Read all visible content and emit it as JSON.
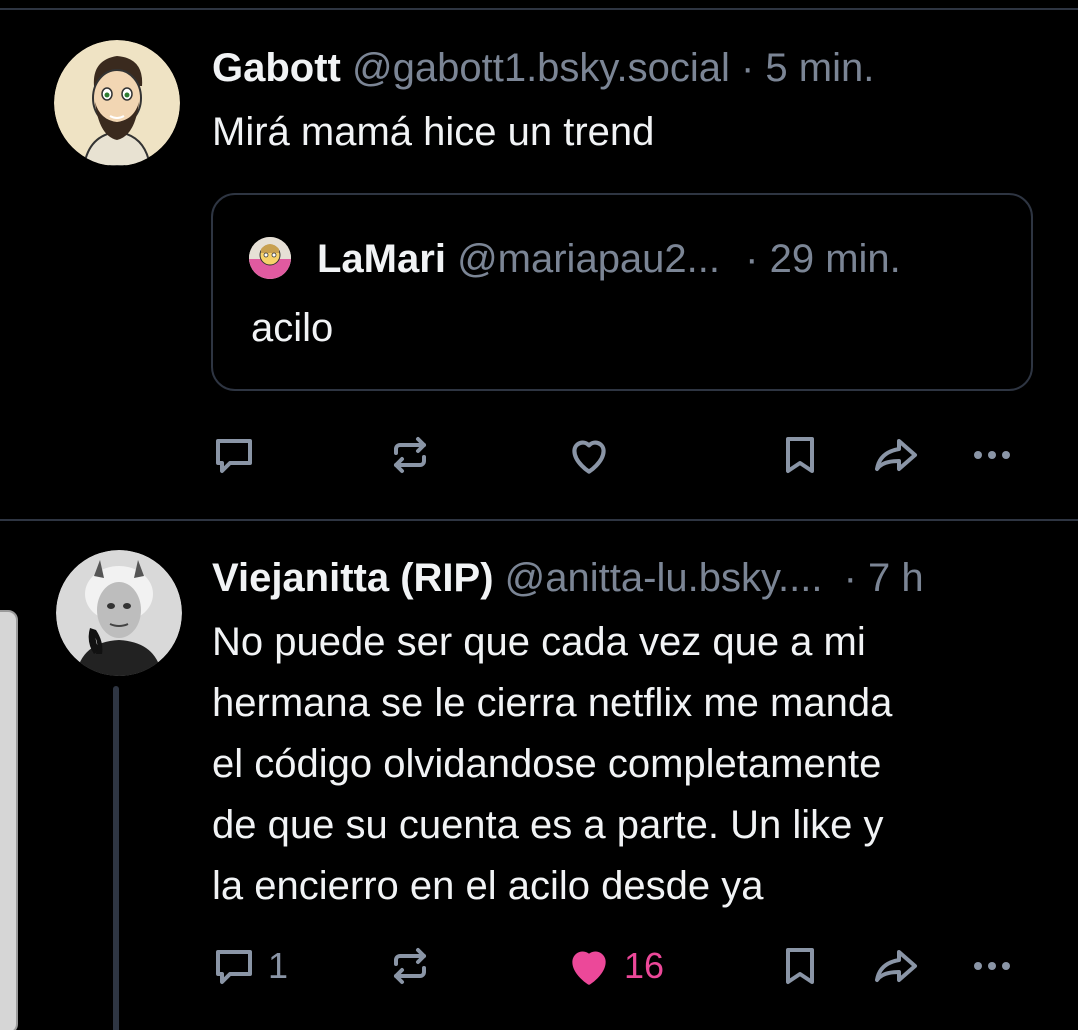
{
  "posts": [
    {
      "author": "Gabott",
      "handle": "@gabott1.bsky.social",
      "separator": "·",
      "time": "5 min.",
      "text": "Mirá mamá hice un trend",
      "quote": {
        "author": "LaMari",
        "handle": "@mariapau2...",
        "separator": "·",
        "time": "29 min.",
        "text": "acilo"
      },
      "actions": {
        "reply_count": "",
        "repost_count": "",
        "like_count": "",
        "liked": false
      }
    },
    {
      "author": "Viejanitta (RIP)",
      "handle": "@anitta-lu.bsky....",
      "separator": "·",
      "time": "7 h",
      "text": "No puede ser que cada vez que a mi\nhermana se le cierra netflix me manda\nel código olvidandose completamente\nde que su cuenta es a parte. Un like y\nla encierro en el acilo desde ya",
      "actions": {
        "reply_count": "1",
        "repost_count": "",
        "like_count": "16",
        "liked": true
      }
    }
  ],
  "colors": {
    "background": "#000000",
    "text": "#f1f3f5",
    "muted": "#7b8595",
    "border": "#2e3542",
    "like_active": "#ec4899"
  },
  "icons": [
    "reply-icon",
    "repost-icon",
    "like-icon",
    "bookmark-icon",
    "share-icon",
    "more-icon"
  ]
}
